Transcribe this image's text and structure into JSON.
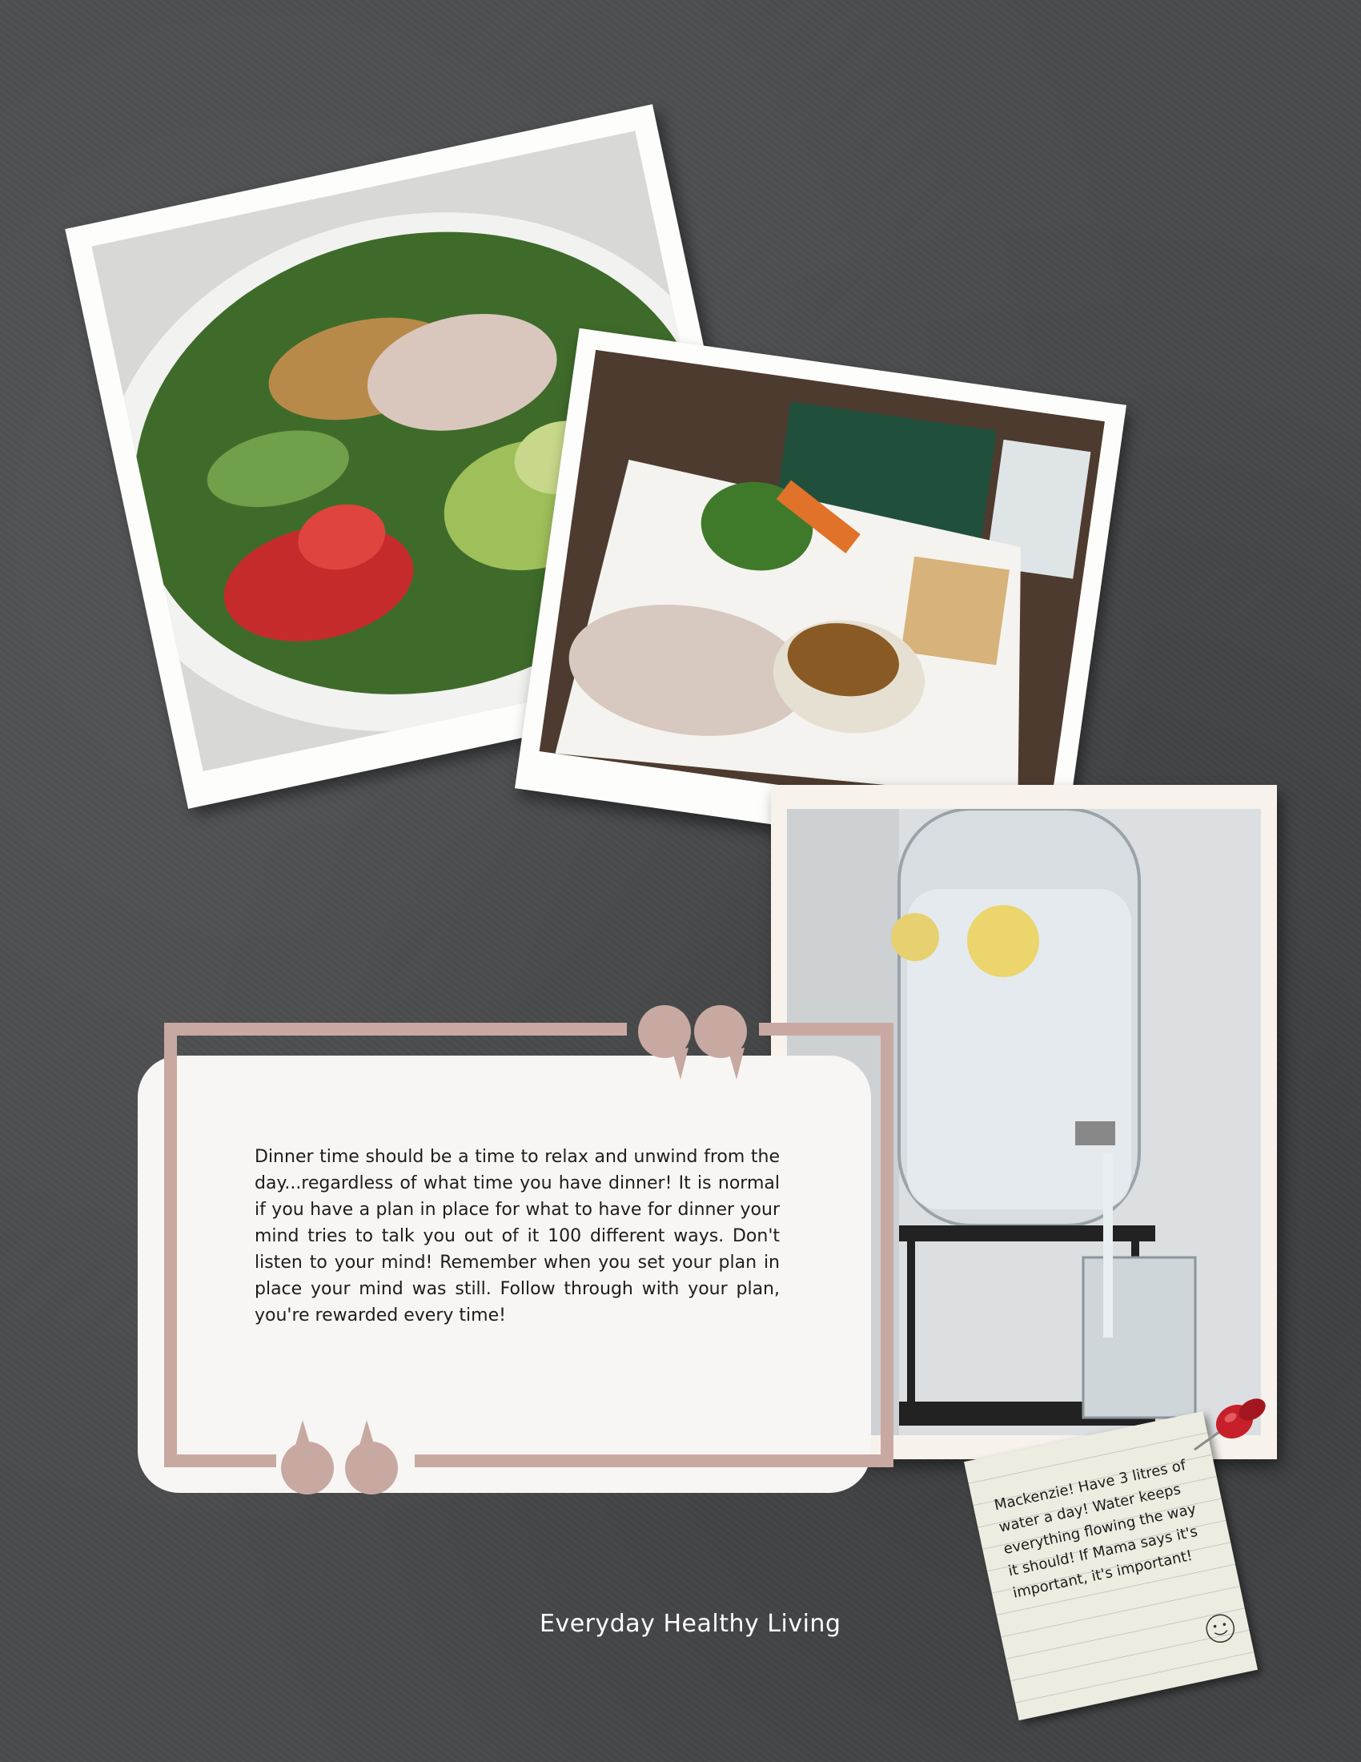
{
  "quote": {
    "text": "Dinner time should be a time to relax and unwind from the day...regardless of what time you have dinner!  It is normal if you have a plan in place for what to have for dinner your mind tries to talk you out of it 100 different ways.  Don't listen to your mind!  Remember when you set your plan in place your mind was still. Follow through with your plan, you're rewarded every time!"
  },
  "sticky_note": {
    "text": "Mackenzie! Have 3 litres of water a day!  Water  keeps everything flowing the way it should! If Mama says it's important, it's important!"
  },
  "footer": {
    "title": "Everyday Healthy Living"
  },
  "colors": {
    "background": "#4a4b4d",
    "accent_frame": "#c8a9a1",
    "card": "#f7f6f4",
    "pushpin": "#c8202a"
  },
  "icons": [
    "quote-open-icon",
    "quote-close-icon",
    "pushpin-icon",
    "smiley-icon"
  ]
}
